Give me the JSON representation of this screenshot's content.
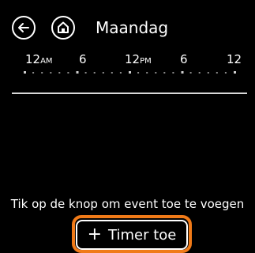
{
  "header": {
    "title": "Maandag",
    "back_icon": "arrow-left-icon",
    "home_icon": "home-icon"
  },
  "timeline": {
    "labels": [
      {
        "main": "12",
        "sub": "AM"
      },
      {
        "main": "6",
        "sub": ""
      },
      {
        "main": "12",
        "sub": "PM"
      },
      {
        "main": "6",
        "sub": ""
      },
      {
        "main": "12",
        "sub": ""
      }
    ]
  },
  "main": {
    "hint": "Tik op de knop om event toe te voegen"
  },
  "action": {
    "plus_icon": "plus-icon",
    "plus_glyph": "+",
    "label": "Timer toe"
  },
  "colors": {
    "background": "#000000",
    "foreground": "#ffffff",
    "focus": "#f07a18"
  }
}
